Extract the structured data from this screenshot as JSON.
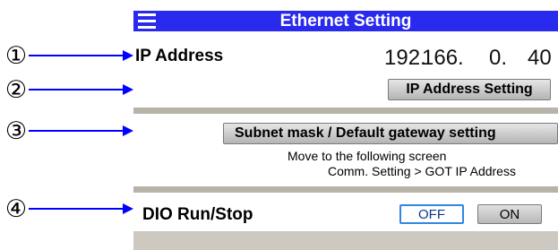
{
  "callouts": [
    "①",
    "②",
    "③",
    "④"
  ],
  "screen": {
    "title": "Ethernet Setting",
    "menu_icon": "hamburger-menu-icon",
    "ip_address": {
      "label": "IP Address",
      "octet1": "192.",
      "octet2": "166.",
      "octet3": "0.",
      "octet4": "40"
    },
    "ip_address_setting_button": "IP Address Setting",
    "subnet_button": "Subnet mask / Default gateway setting",
    "note_line1": "Move to the following screen",
    "note_line2": "Comm. Setting > GOT IP Address",
    "dio": {
      "label": "DIO Run/Stop",
      "off_label": "OFF",
      "on_label": "ON",
      "selected": "OFF"
    }
  },
  "colors": {
    "title_bar": "#2a2aee",
    "arrow": "#0000ff",
    "divider": "#b7b3a9",
    "toggle_selected_border": "#2f87e0"
  }
}
